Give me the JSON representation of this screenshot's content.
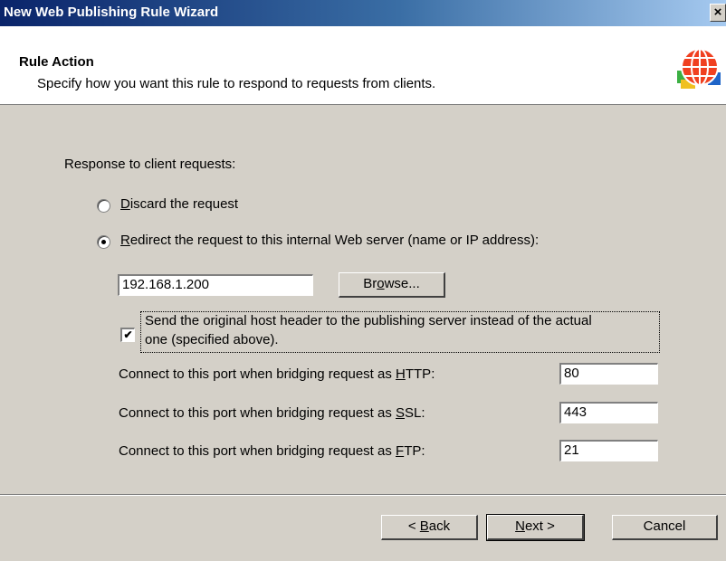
{
  "window": {
    "title": "New Web Publishing Rule Wizard",
    "close_label": "×"
  },
  "header": {
    "title": "Rule Action",
    "subtitle": "Specify how you want this rule to respond to requests from clients.",
    "icon": "globe-icon"
  },
  "section_label": "Response to client requests:",
  "options": {
    "discard": {
      "label_first": "D",
      "label_rest": "iscard the request",
      "selected": false
    },
    "redirect": {
      "label_first": "R",
      "label_rest": "edirect the request to this internal Web server (name or IP address):",
      "selected": true
    }
  },
  "server": {
    "value": "192.168.1.200",
    "browse_label_pre": "Br",
    "browse_label_u": "o",
    "browse_label_post": "wse..."
  },
  "host_header": {
    "checked": true,
    "line1": "Send the original host header to the publishing server instead of the actual",
    "line2": "one (specified above)."
  },
  "ports": [
    {
      "label_pre": "Connect to this port when bridging request as ",
      "label_u": "H",
      "label_post": "TTP:",
      "value": "80"
    },
    {
      "label_pre": "Connect to this port when bridging request as ",
      "label_u": "S",
      "label_post": "SL:",
      "value": "443"
    },
    {
      "label_pre": "Connect to this port when bridging request as ",
      "label_u": "F",
      "label_post": "TP:",
      "value": "21"
    }
  ],
  "buttons": {
    "back_pre": "< ",
    "back_u": "B",
    "back_post": "ack",
    "next_u": "N",
    "next_post": "ext >",
    "cancel": "Cancel"
  },
  "colors": {
    "titlebar": "#0a246a",
    "dialog_bg": "#d4d0c8"
  }
}
